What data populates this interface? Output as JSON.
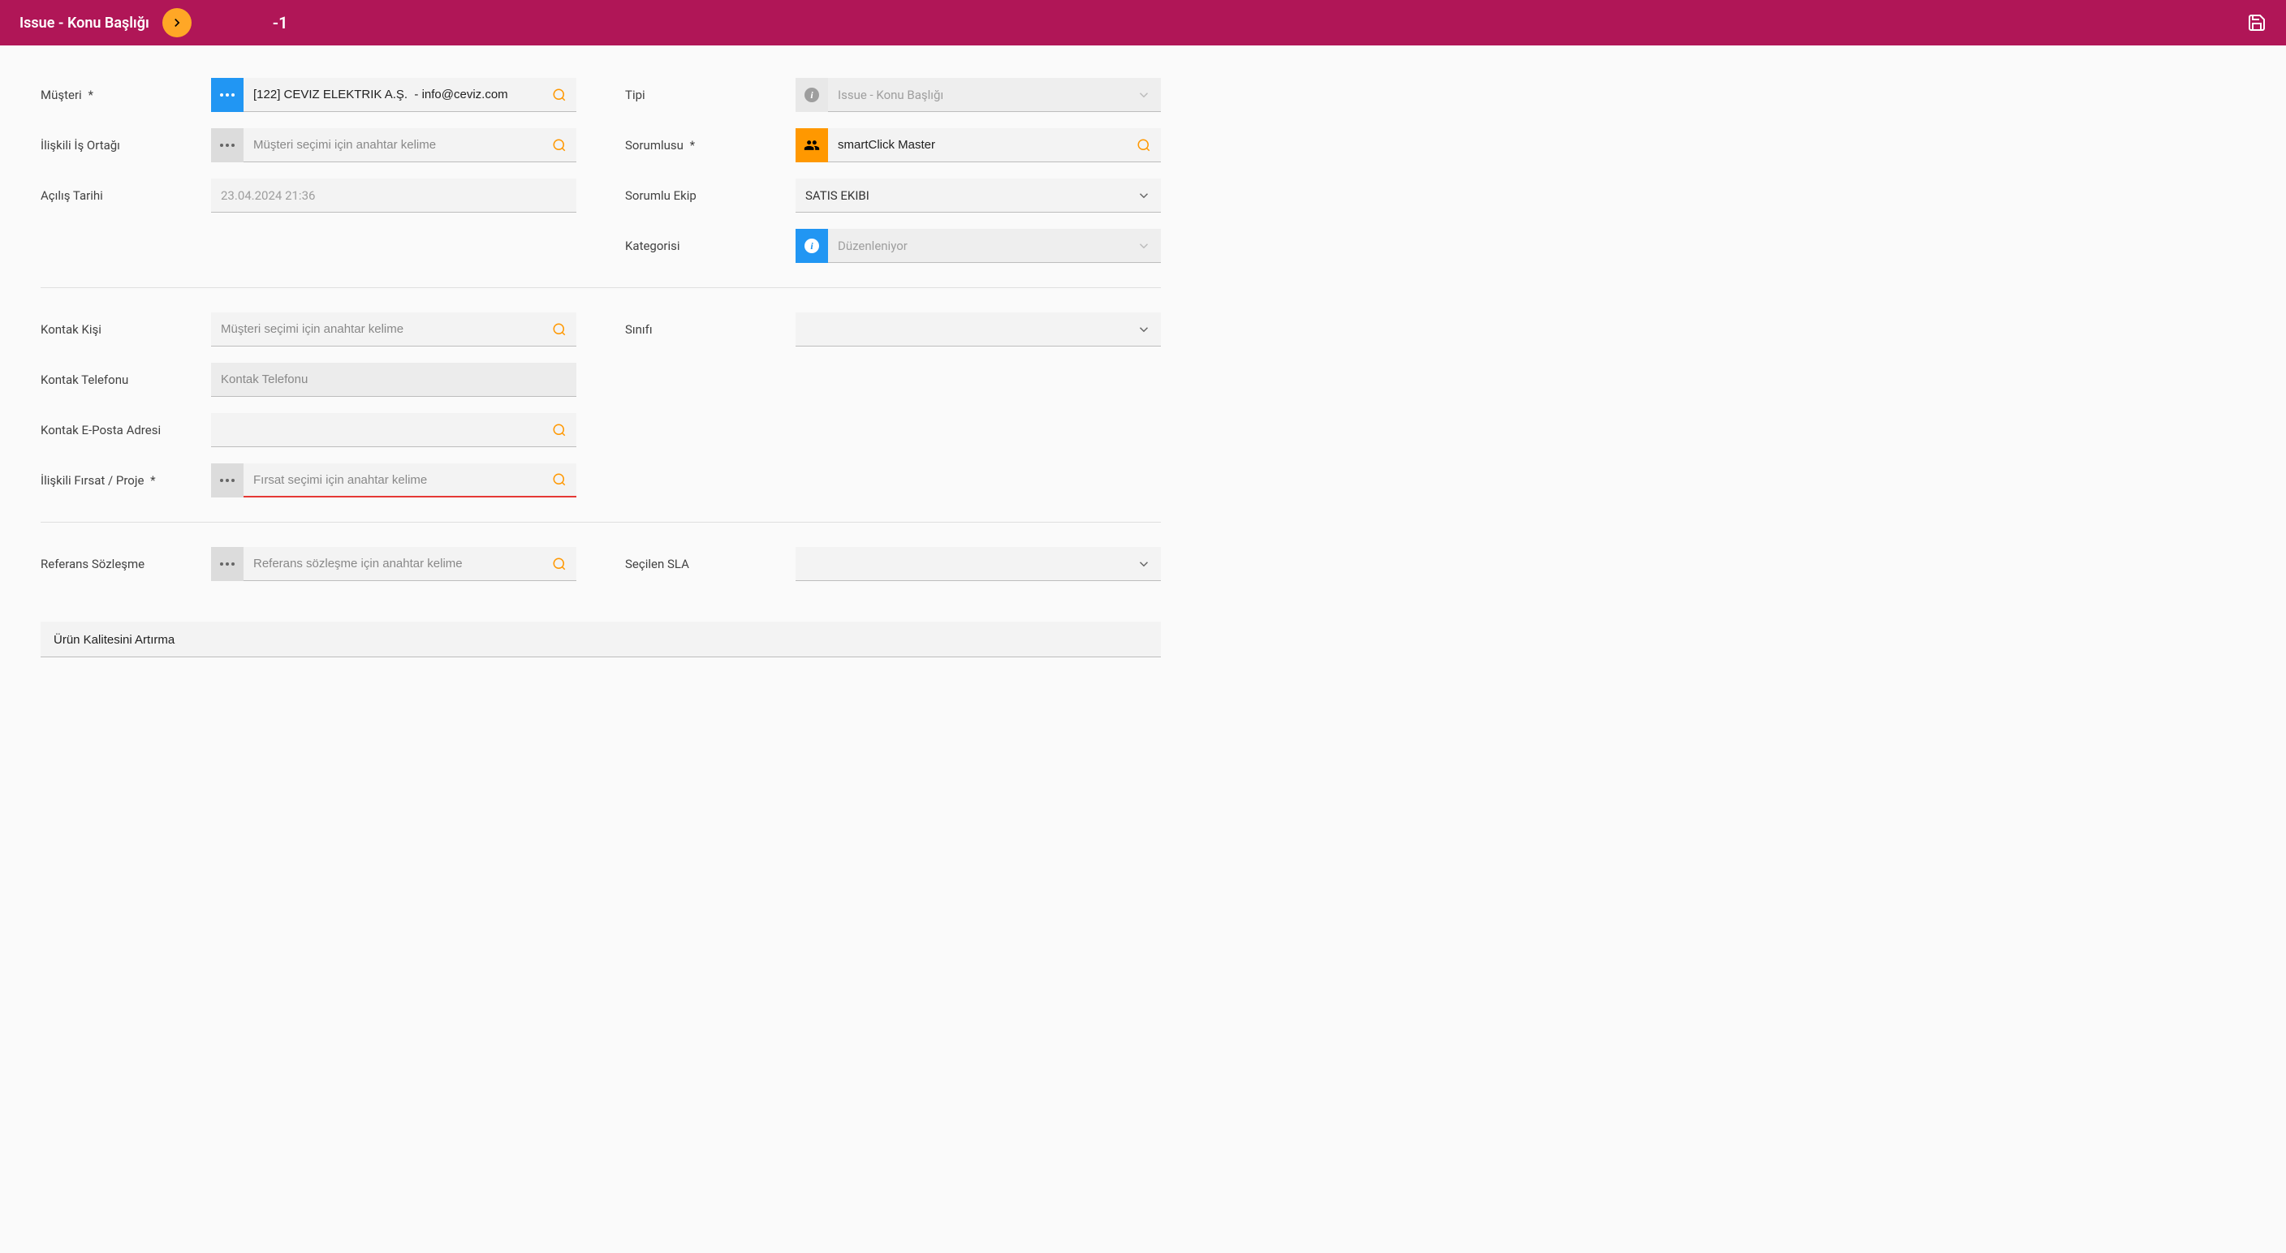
{
  "header": {
    "title": "Issue - Konu Başlığı",
    "id": "-1"
  },
  "labels": {
    "musteri": "Müşteri",
    "iliskili_is_ortagi": "İlişkili İş Ortağı",
    "acilis_tarihi": "Açılış Tarihi",
    "tipi": "Tipi",
    "sorumlusu": "Sorumlusu",
    "sorumlu_ekip": "Sorumlu Ekip",
    "kategorisi": "Kategorisi",
    "kontak_kisi": "Kontak Kişi",
    "kontak_telefonu": "Kontak Telefonu",
    "kontak_eposta": "Kontak E-Posta Adresi",
    "iliskili_firsat": "İlişkili Fırsat / Proje",
    "sinifi": "Sınıfı",
    "referans_sozlesme": "Referans Sözleşme",
    "secilen_sla": "Seçilen SLA",
    "required": "*"
  },
  "values": {
    "musteri": "[122] CEVIZ ELEKTRIK A.Ş.  - info@ceviz.com",
    "acilis_tarihi": "23.04.2024 21:36",
    "tipi": "Issue - Konu Başlığı",
    "sorumlusu": "smartClick Master",
    "sorumlu_ekip": "SATIS EKIBI",
    "kategorisi": "Düzenleniyor",
    "urun": "Ürün Kalitesini Artırma"
  },
  "placeholders": {
    "musteri_secimi": "Müşteri seçimi için anahtar kelime",
    "kontak_telefonu": "Kontak Telefonu",
    "firsat_secimi": "Fırsat seçimi için anahtar kelime",
    "referans_sozlesme": "Referans sözleşme için anahtar kelime"
  }
}
